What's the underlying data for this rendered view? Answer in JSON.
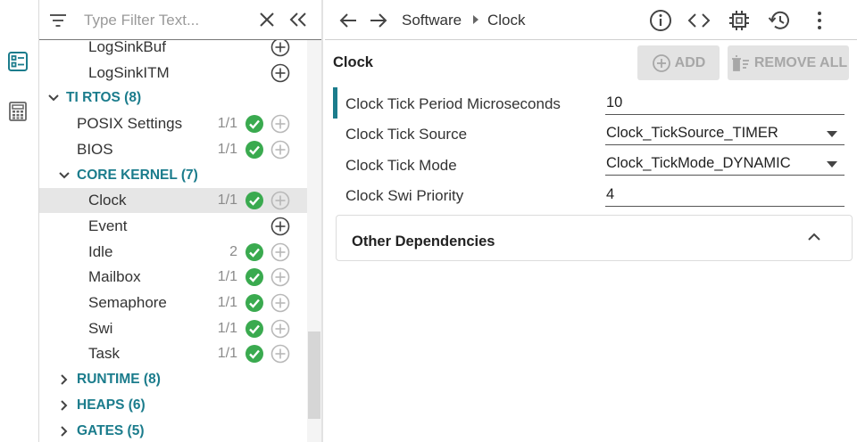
{
  "filter": {
    "placeholder": "Type Filter Text..."
  },
  "rail": {
    "items": [
      {
        "icon": "list-view-icon",
        "active": true
      },
      {
        "icon": "calculator-icon",
        "active": false
      }
    ]
  },
  "tree": {
    "items": [
      {
        "kind": "leaf",
        "label": "LogSinkBuf",
        "indent": 2,
        "count": "",
        "ok": false,
        "plus_active": true
      },
      {
        "kind": "leaf",
        "label": "LogSinkITM",
        "indent": 2,
        "count": "",
        "ok": false,
        "plus_active": true
      },
      {
        "kind": "category",
        "label": "TI RTOS (8)",
        "indent": 0,
        "expanded": true
      },
      {
        "kind": "leaf",
        "label": "POSIX Settings",
        "indent": 1,
        "count": "1/1",
        "ok": true,
        "plus_active": false
      },
      {
        "kind": "leaf",
        "label": "BIOS",
        "indent": 1,
        "count": "1/1",
        "ok": true,
        "plus_active": false
      },
      {
        "kind": "category",
        "label": "CORE KERNEL (7)",
        "indent": 1,
        "expanded": true
      },
      {
        "kind": "leaf",
        "label": "Clock",
        "indent": 2,
        "count": "1/1",
        "ok": true,
        "plus_active": false,
        "selected": true
      },
      {
        "kind": "leaf",
        "label": "Event",
        "indent": 2,
        "count": "",
        "ok": false,
        "plus_active": true
      },
      {
        "kind": "leaf",
        "label": "Idle",
        "indent": 2,
        "count": "2",
        "ok": true,
        "plus_active": false
      },
      {
        "kind": "leaf",
        "label": "Mailbox",
        "indent": 2,
        "count": "1/1",
        "ok": true,
        "plus_active": false
      },
      {
        "kind": "leaf",
        "label": "Semaphore",
        "indent": 2,
        "count": "1/1",
        "ok": true,
        "plus_active": false
      },
      {
        "kind": "leaf",
        "label": "Swi",
        "indent": 2,
        "count": "1/1",
        "ok": true,
        "plus_active": false
      },
      {
        "kind": "leaf",
        "label": "Task",
        "indent": 2,
        "count": "1/1",
        "ok": true,
        "plus_active": false
      },
      {
        "kind": "category",
        "label": "RUNTIME (8)",
        "indent": 1,
        "expanded": false
      },
      {
        "kind": "category",
        "label": "HEAPS (6)",
        "indent": 1,
        "expanded": false
      },
      {
        "kind": "category",
        "label": "GATES (5)",
        "indent": 1,
        "expanded": false
      }
    ]
  },
  "breadcrumb": {
    "parent": "Software",
    "current": "Clock"
  },
  "toolbar_icons": [
    "info-icon",
    "code-icon",
    "chip-icon",
    "history-icon",
    "more-vert-icon"
  ],
  "panel": {
    "title": "Clock",
    "add_label": "ADD",
    "remove_all_label": "REMOVE ALL",
    "properties": [
      {
        "label": "Clock Tick Period Microseconds",
        "value": "10",
        "type": "text"
      },
      {
        "label": "Clock Tick Source",
        "value": "Clock_TickSource_TIMER",
        "type": "select"
      },
      {
        "label": "Clock Tick Mode",
        "value": "Clock_TickMode_DYNAMIC",
        "type": "select"
      },
      {
        "label": "Clock Swi Priority",
        "value": "4",
        "type": "text"
      }
    ],
    "deps_title": "Other Dependencies"
  },
  "colors": {
    "accent": "#1b7c8c",
    "ok": "#3aaa4f",
    "selected_row": "#e6e6e6",
    "disabled_btn": "#e3e3e3"
  }
}
